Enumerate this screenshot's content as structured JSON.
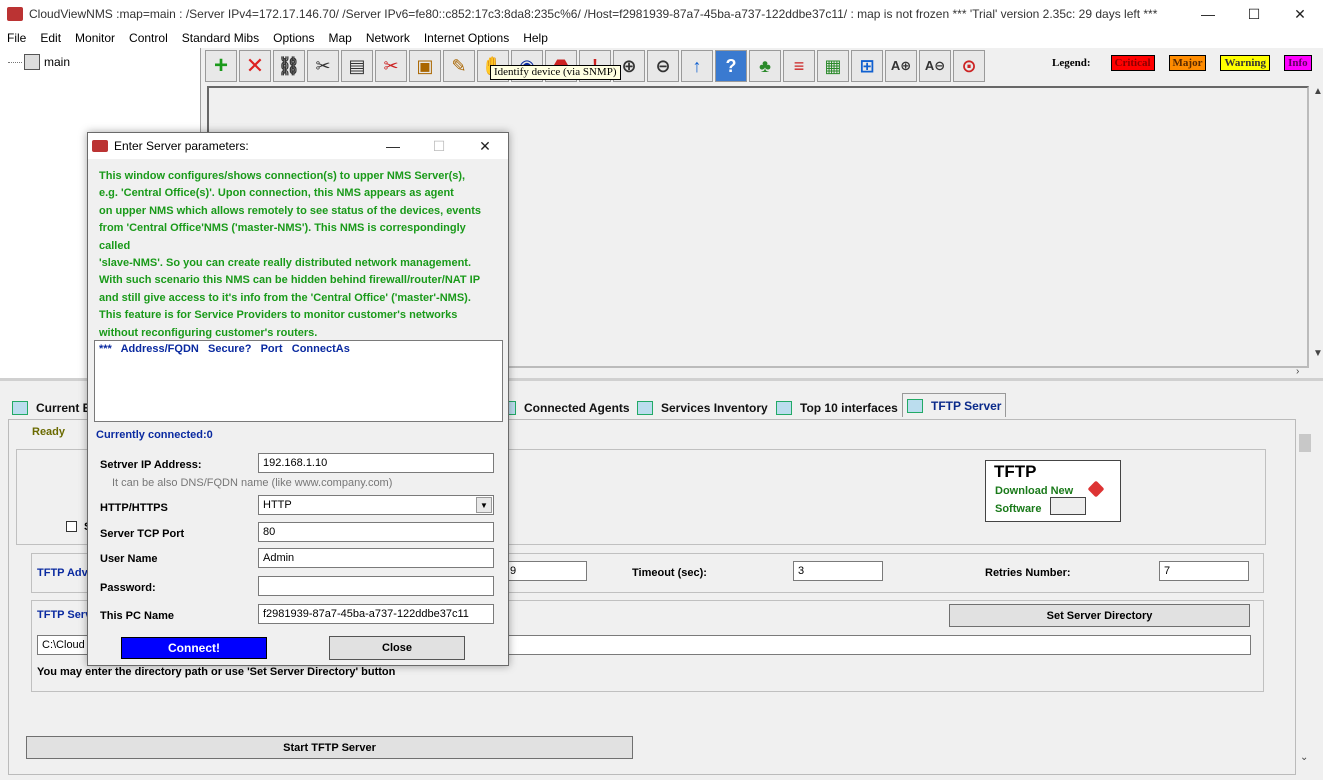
{
  "window": {
    "title": "CloudViewNMS :map=main :  /Server IPv4=172.17.146.70/ /Server IPv6=fe80::c852:17c3:8da8:235c%6/ /Host=f2981939-87a7-45ba-a737-122ddbe37c11/  : map is not frozen        *** 'Trial' version 2.35c: 29 days left ***",
    "minimize": "—",
    "maximize": "☐",
    "close": "✕"
  },
  "menu": [
    "File",
    "Edit",
    "Monitor",
    "Control",
    "Standard Mibs",
    "Options",
    "Map",
    "Network",
    "Internet Options",
    "Help"
  ],
  "tree": {
    "root": "main"
  },
  "toolbar": {
    "tooltip": "Identify device (via SNMP)",
    "buttons": [
      "add-icon",
      "delete-icon",
      "link-icon",
      "unlink-icon",
      "properties-icon",
      "cut-icon",
      "paste-icon",
      "edit-icon",
      "identify-icon",
      "mib-icon",
      "stop-icon",
      "alarm-icon",
      "zoom-in-icon",
      "zoom-out-icon",
      "up-icon",
      "help-icon",
      "tree-icon",
      "bars-icon",
      "map-icon",
      "grid-icon",
      "find-a-icon",
      "find-a2-icon",
      "zoom-reset-icon"
    ]
  },
  "legend": {
    "label": "Legend:",
    "items": [
      {
        "text": "Critical",
        "color": "#ff0000"
      },
      {
        "text": "Major",
        "color": "#ff8c00"
      },
      {
        "text": "Warning",
        "color": "#ffff00"
      },
      {
        "text": "Info",
        "color": "#ff00ff"
      }
    ]
  },
  "tabs": {
    "current": "Current E",
    "connected_agents": "Connected Agents",
    "services_inventory": "Services Inventory",
    "top10": "Top 10 interfaces",
    "tftp": "TFTP Server"
  },
  "bottom": {
    "status": "Ready",
    "checkbox_label": "S",
    "tftp_adv_label": "TFTP Adva",
    "adv_value": "9",
    "timeout_label": "Timeout (sec):",
    "timeout_value": "3",
    "retries_label": "Retries Number:",
    "retries_value": "7",
    "tftp_server_label": "TFTP Serv",
    "set_dir_button": "Set Server Directory",
    "dir_value": "C:\\Cloud",
    "dir_hint": "You may enter the directory path or use 'Set Server Directory' button",
    "start_button": "Start TFTP Server",
    "logo": {
      "title": "TFTP",
      "line1": "Download New",
      "line2": "Software"
    }
  },
  "dialog": {
    "title": "Enter Server parameters:",
    "minimize": "—",
    "maximize": "☐",
    "close": "✕",
    "description": [
      "This window configures/shows connection(s) to upper NMS Server(s),",
      "e.g. 'Central Office(s)'. Upon connection, this NMS appears as agent",
      "on upper NMS which allows remotely to see status of the devices, events",
      "from 'Central Office'NMS ('master-NMS'). This NMS is correspondingly called",
      "'slave-NMS'. So you can create really distributed network management.",
      "With such scenario this NMS can be hidden behind firewall/router/NAT IP",
      "and still give access to it's info from the 'Central Office' ('master'-NMS).",
      "This feature is for Service Providers to monitor customer's networks",
      "without reconfiguring customer's routers."
    ],
    "list_header": "***   Address/FQDN   Secure?   Port   ConnectAs",
    "connected": "Currently connected:0",
    "ip_label": "Setrver IP Address:",
    "ip_value": "192.168.1.10",
    "ip_hint": "It can be also DNS/FQDN name (like www.company.com)",
    "http_label": "HTTP/HTTPS",
    "http_value": "HTTP",
    "port_label": "Server TCP Port",
    "port_value": "80",
    "user_label": "User Name",
    "user_value": "Admin",
    "pass_label": "Password:",
    "pass_value": "",
    "pc_label": "This PC Name",
    "pc_value": "f2981939-87a7-45ba-a737-122ddbe37c11",
    "connect_button": "Connect!",
    "close_button": "Close"
  }
}
